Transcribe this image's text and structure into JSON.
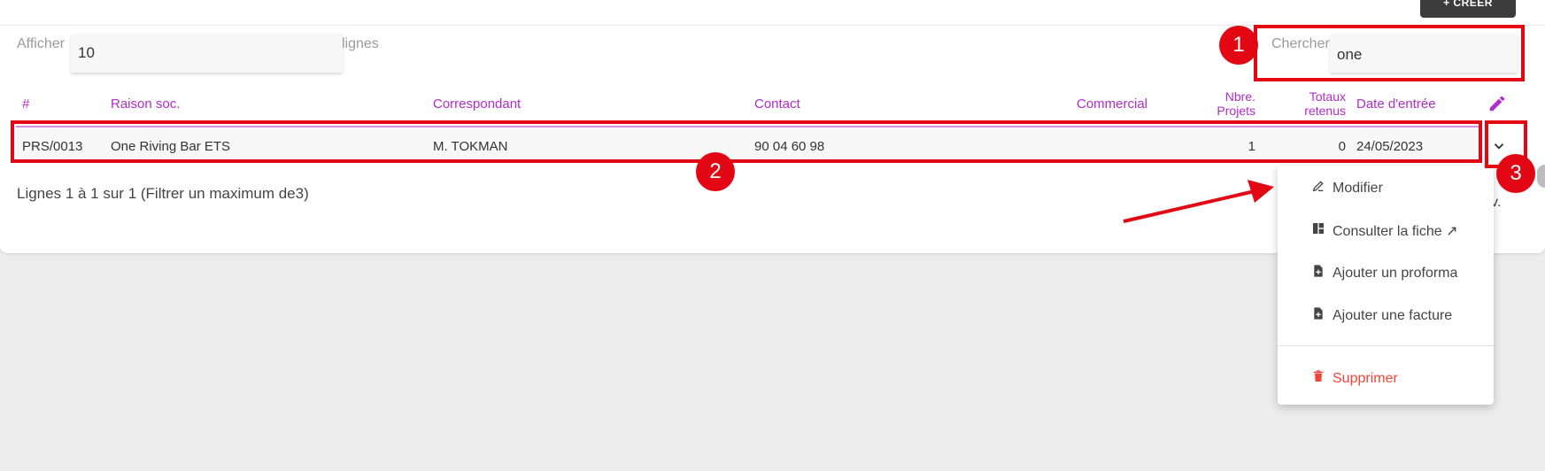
{
  "header": {
    "create_label": "+ CRÉER"
  },
  "filters": {
    "show_label": "Afficher",
    "show_value": "10",
    "lines_label": "lignes",
    "search_label": "Chercher:",
    "search_value": "one"
  },
  "table": {
    "columns": {
      "id": "#",
      "raison": "Raison soc.",
      "correspondant": "Correspondant",
      "contact": "Contact",
      "commercial": "Commercial",
      "nbre_projets": "Nbre. Projets",
      "totaux_retenus": "Totaux retenus",
      "date": "Date d'entrée"
    },
    "rows": [
      {
        "id": "PRS/0013",
        "raison": "One Riving Bar ETS",
        "correspondant": "M. TOKMAN",
        "contact": "90 04 60 98",
        "commercial": "",
        "nbre_projets": "1",
        "totaux_retenus": "0",
        "date": "24/05/2023"
      }
    ]
  },
  "footer": {
    "text": "Lignes 1 à 1 sur 1 (Filtrer un maximum de3)",
    "tail": "v."
  },
  "menu": {
    "items": [
      {
        "label": "Modifier",
        "icon": "pencil-icon"
      },
      {
        "label": "Consulter la fiche ↗",
        "icon": "layout-icon"
      },
      {
        "label": "Ajouter un proforma",
        "icon": "file-plus-icon"
      },
      {
        "label": "Ajouter une facture",
        "icon": "file-plus-icon"
      },
      {
        "label": "Supprimer",
        "icon": "trash-icon"
      }
    ]
  },
  "annotations": {
    "b1": "1",
    "b2": "2",
    "b3": "3"
  },
  "colors": {
    "accent": "#b02cc8",
    "highlight": "#e30613",
    "danger": "#f44336"
  }
}
